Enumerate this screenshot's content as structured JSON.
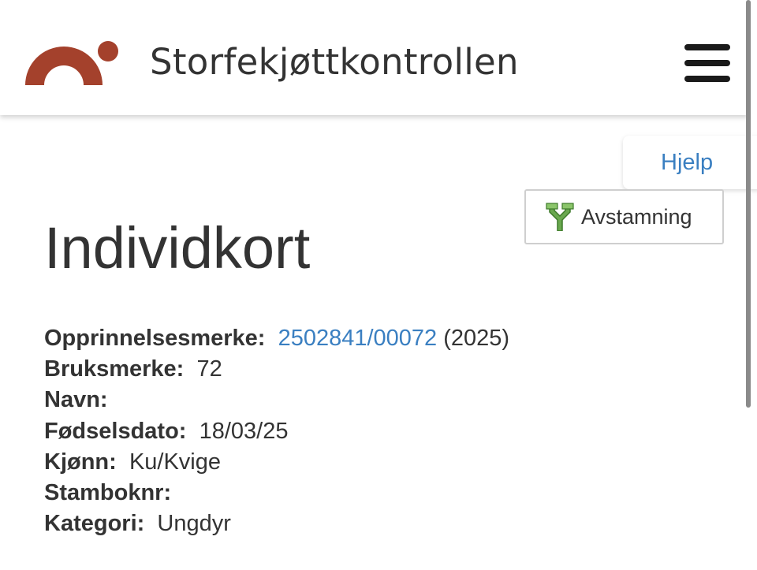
{
  "header": {
    "site_title": "Storfekjøttkontrollen",
    "brand_color": "#a4412c",
    "menu_icon": "hamburger-menu-icon"
  },
  "actions": {
    "help_label": "Hjelp",
    "pedigree_label": "Avstamning",
    "pedigree_icon": "pedigree-tree-icon",
    "pedigree_icon_color": "#6aa84f"
  },
  "main": {
    "title": "Individkort",
    "fields": [
      {
        "label": "Opprinnelsesmerke:",
        "value": "2502841/00072",
        "suffix": "(2025)"
      },
      {
        "label": "Bruksmerke:",
        "value": "72"
      },
      {
        "label": "Navn:",
        "value": ""
      },
      {
        "label": "Fødselsdato:",
        "value": "18/03/25"
      },
      {
        "label": "Kjønn:",
        "value": "Ku/Kvige"
      },
      {
        "label": "Stamboknr:",
        "value": ""
      },
      {
        "label": "Kategori:",
        "value": "Ungdyr"
      }
    ]
  },
  "colors": {
    "link": "#3a7fc1",
    "text": "#333333"
  }
}
